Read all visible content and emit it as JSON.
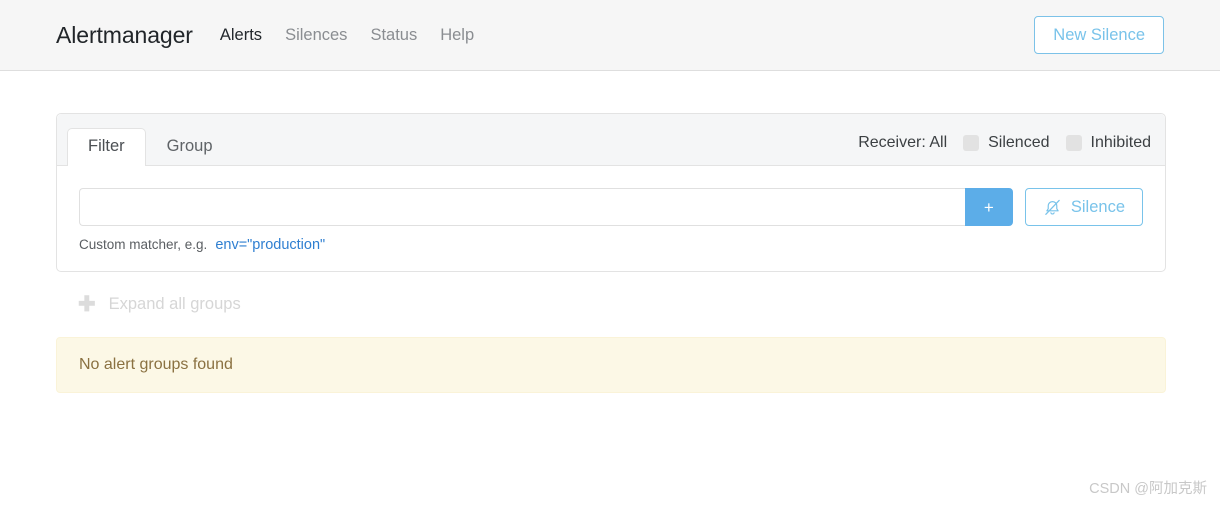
{
  "navbar": {
    "brand": "Alertmanager",
    "links": [
      {
        "label": "Alerts",
        "active": true
      },
      {
        "label": "Silences",
        "active": false
      },
      {
        "label": "Status",
        "active": false
      },
      {
        "label": "Help",
        "active": false
      }
    ],
    "new_silence_label": "New Silence"
  },
  "filter_card": {
    "tabs": [
      {
        "label": "Filter",
        "active": true
      },
      {
        "label": "Group",
        "active": false
      }
    ],
    "receiver_label": "Receiver: All",
    "checkboxes": [
      {
        "label": "Silenced",
        "checked": false
      },
      {
        "label": "Inhibited",
        "checked": false
      }
    ],
    "matcher_input": {
      "value": "",
      "placeholder": ""
    },
    "add_button_label": "+",
    "silence_button_label": "Silence",
    "silence_button_icon": "bell-slash-icon",
    "hint_text": "Custom matcher, e.g.",
    "hint_code": "env=\"production\""
  },
  "expand": {
    "icon": "plus-icon",
    "label": "Expand all groups"
  },
  "alert_banner": {
    "message": "No alert groups found"
  },
  "watermark": {
    "text": "CSDN @阿加克斯"
  },
  "colors": {
    "accent_blue": "#5cade8",
    "link_blue": "#79c3ea",
    "banner_bg": "#fcf8e6",
    "banner_text": "#8a7141",
    "header_bg": "#f6f6f6"
  }
}
